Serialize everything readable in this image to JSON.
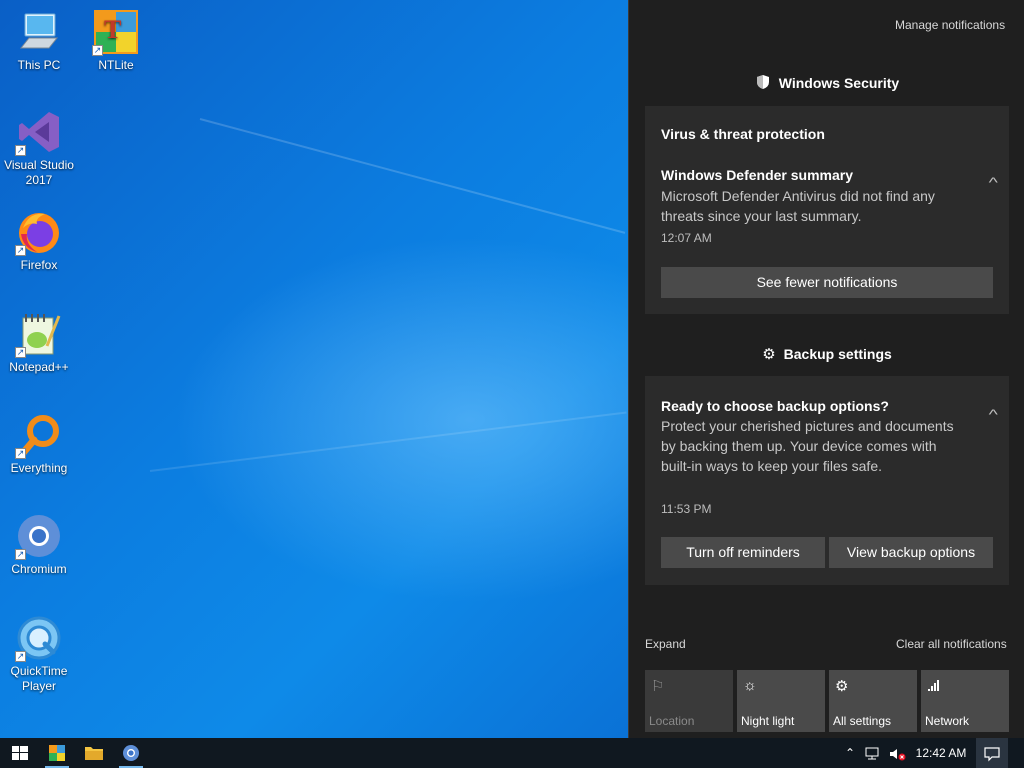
{
  "desktop": {
    "icons": [
      {
        "label": "This PC",
        "icon": "computer-icon"
      },
      {
        "label": "NTLite",
        "icon": "ntlite-icon"
      },
      {
        "label": "Visual Studio 2017",
        "icon": "visual-studio-icon"
      },
      {
        "label": "Firefox",
        "icon": "firefox-icon"
      },
      {
        "label": "Notepad++",
        "icon": "notepadpp-icon"
      },
      {
        "label": "Everything",
        "icon": "search-magnifier-icon"
      },
      {
        "label": "Chromium",
        "icon": "chromium-icon"
      },
      {
        "label": "QuickTime Player",
        "icon": "quicktime-icon"
      }
    ]
  },
  "action_center": {
    "manage_notifications": "Manage notifications",
    "groups": [
      {
        "app": "Windows Security",
        "icon": "shield-icon",
        "card_title": "Virus & threat protection",
        "notification": {
          "title": "Windows Defender summary",
          "body": "Microsoft Defender Antivirus did not find any threats since your last summary.",
          "time": "12:07 AM"
        },
        "buttons": [
          "See fewer notifications"
        ]
      },
      {
        "app": "Backup settings",
        "icon": "gear-icon",
        "notification": {
          "title": "Ready to choose backup options?",
          "body": "Protect your cherished pictures and documents by backing them up. Your device comes with built-in ways to keep your files safe.",
          "time": "11:53 PM"
        },
        "buttons": [
          "Turn off reminders",
          "View backup options"
        ]
      }
    ],
    "expand": "Expand",
    "clear_all": "Clear all notifications",
    "quick_actions": [
      {
        "label": "Location",
        "icon": "location-icon",
        "enabled": false
      },
      {
        "label": "Night light",
        "icon": "brightness-icon",
        "enabled": true
      },
      {
        "label": "All settings",
        "icon": "gear-icon",
        "enabled": true
      },
      {
        "label": "Network",
        "icon": "network-icon",
        "enabled": true
      }
    ]
  },
  "taskbar": {
    "pinned": [
      {
        "name": "start",
        "icon": "windows-logo-icon"
      },
      {
        "name": "ntlite",
        "icon": "ntlite-icon"
      },
      {
        "name": "file-explorer",
        "icon": "folder-icon"
      },
      {
        "name": "chromium",
        "icon": "chromium-icon"
      }
    ],
    "tray": {
      "clock": "12:42 AM",
      "icons": [
        "chevron-up-icon",
        "network-icon",
        "volume-muted-icon",
        "action-center-icon"
      ]
    }
  }
}
